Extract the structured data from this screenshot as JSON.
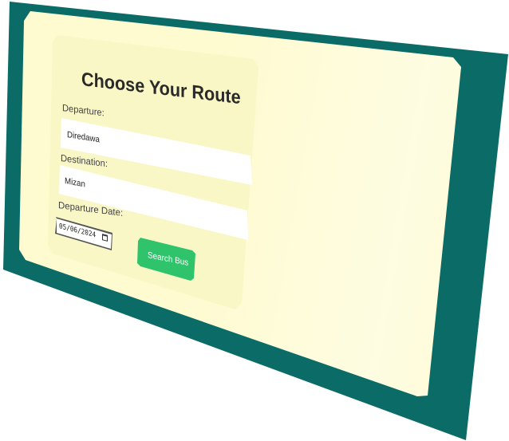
{
  "form": {
    "title": "Choose Your Route",
    "departure_label": "Departure:",
    "departure_value": "Diredawa",
    "destination_label": "Destination:",
    "destination_value": "Mizan",
    "date_label": "Departure Date:",
    "date_value": "05/06/2024",
    "search_label": "Search Bus"
  },
  "colors": {
    "backdrop": "#0b6b66",
    "panel": "#fefbd1",
    "button": "#2fc46b"
  },
  "icons": {
    "date_picker": "calendar-icon"
  }
}
